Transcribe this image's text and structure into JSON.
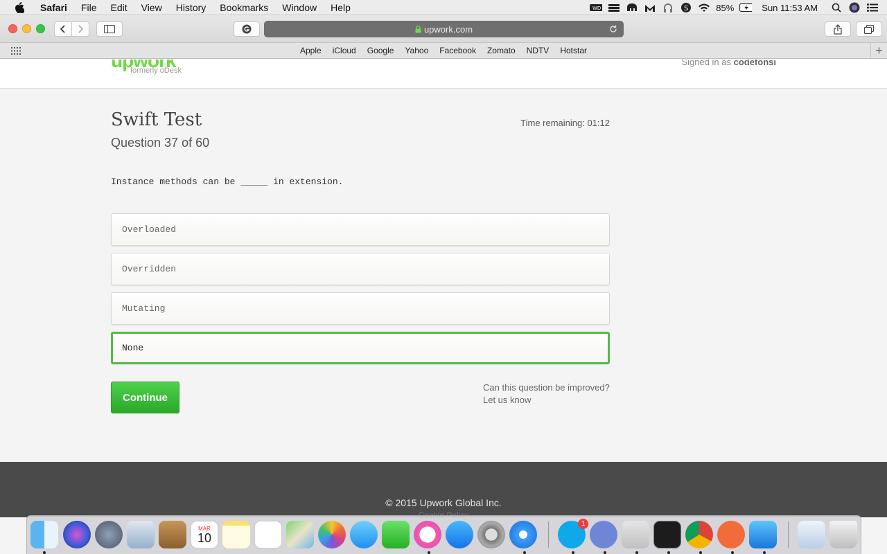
{
  "menubar": {
    "app_name": "Safari",
    "items": [
      "File",
      "Edit",
      "View",
      "History",
      "Bookmarks",
      "Window",
      "Help"
    ],
    "battery": "85%",
    "clock": "Sun 11:53 AM"
  },
  "browser": {
    "url": "upwork.com",
    "bookmarks": [
      "Apple",
      "iCloud",
      "Google",
      "Yahoo",
      "Facebook",
      "Zomato",
      "NDTV",
      "Hotstar"
    ]
  },
  "site": {
    "logo": "upwork",
    "logo_sub": "formerly oDesk",
    "signed_in_prefix": "Signed in as",
    "username": "codefonsi"
  },
  "test": {
    "title": "Swift Test",
    "question_progress": "Question 37 of 60",
    "time_remaining": "Time remaining: 01:12",
    "question": "Instance methods can be _____ in extension.",
    "options": [
      "Overloaded",
      "Overridden",
      "Mutating",
      "None"
    ],
    "selected_option": "None",
    "continue_label": "Continue",
    "improve_line1": "Can this question be improved?",
    "improve_line2": "Let us know"
  },
  "footer": {
    "copyright": "© 2015 Upwork Global Inc.",
    "cookie": "Cookie Policy"
  },
  "dock": {
    "apps": [
      "Finder",
      "Siri",
      "Launchpad",
      "Mail",
      "Contacts",
      "Calendar",
      "Notes",
      "Reminders",
      "Maps",
      "Photos",
      "Messages",
      "FaceTime",
      "iTunes",
      "App Store",
      "System Preferences",
      "Safari",
      "Skype",
      "Discord",
      "Keychain Access",
      "Terminal",
      "Chrome",
      "Postman",
      "Xcode",
      "Documents",
      "Trash"
    ],
    "calendar_month": "MAR",
    "calendar_day": "10",
    "skype_badge": "1"
  },
  "colors": {
    "upwork_green": "#6fda44",
    "selected_border": "#54bb47",
    "continue_button": "#3cbf3a"
  }
}
